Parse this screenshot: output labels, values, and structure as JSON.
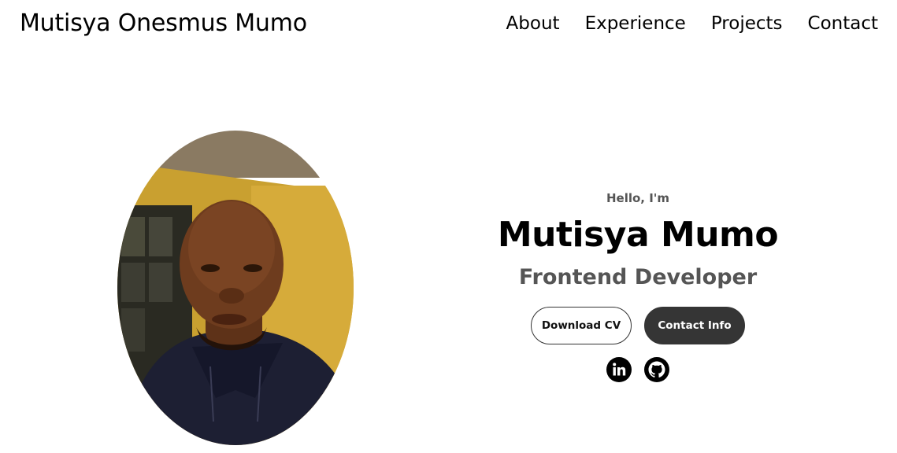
{
  "header": {
    "logo": "Mutisya Onesmus Mumo",
    "nav": [
      "About",
      "Experience",
      "Projects",
      "Contact"
    ]
  },
  "hero": {
    "greeting": "Hello, I'm",
    "name": "Mutisya Mumo",
    "role": "Frontend Developer",
    "buttons": {
      "download": "Download CV",
      "contact": "Contact Info"
    },
    "socials": [
      "linkedin-icon",
      "github-icon"
    ],
    "portrait": "profile-photo"
  },
  "colors": {
    "text": "#000000",
    "muted": "#555555",
    "button_dark": "#353535",
    "background": "#ffffff"
  }
}
